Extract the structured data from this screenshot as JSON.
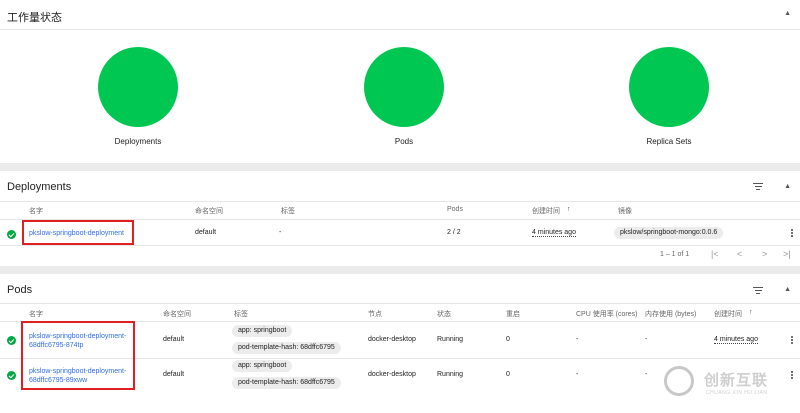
{
  "workload": {
    "title": "工作量状态",
    "items": [
      {
        "label": "Deployments",
        "color": "#00c752"
      },
      {
        "label": "Pods",
        "color": "#00c752"
      },
      {
        "label": "Replica Sets",
        "color": "#00c752"
      }
    ]
  },
  "deployments": {
    "title": "Deployments",
    "headers": {
      "name": "名字",
      "namespace": "命名空间",
      "labels": "标签",
      "pods": "Pods",
      "created": "创建时间",
      "sort": "↑",
      "images": "镜像"
    },
    "rows": [
      {
        "name": "pkslow-springboot-deployment",
        "namespace": "default",
        "labels": "-",
        "pods": "2 / 2",
        "created": "4 minutes ago",
        "image": "pkslow/springboot-mongo:0.0.6"
      }
    ],
    "pagination": {
      "range": "1 – 1 of 1",
      "first": "|<",
      "prev": "<",
      "next": ">",
      "last": ">|"
    }
  },
  "pods": {
    "title": "Pods",
    "headers": {
      "name": "名字",
      "namespace": "命名空间",
      "labels": "标签",
      "node": "节点",
      "status": "状态",
      "restarts": "重启",
      "cpu": "CPU 使用率 (cores)",
      "memory": "内存使用 (bytes)",
      "created": "创建时间",
      "sort": "↑"
    },
    "rows": [
      {
        "name_line1": "pkslow-springboot-deployment-",
        "name_line2": "68dffc6795-874tp",
        "namespace": "default",
        "label1": "app: springboot",
        "label2": "pod-template-hash: 68dffc6795",
        "node": "docker-desktop",
        "status": "Running",
        "restarts": "0",
        "cpu": "-",
        "memory": "-",
        "created": "4 minutes ago"
      },
      {
        "name_line1": "pkslow-springboot-deployment-",
        "name_line2": "68dffc6795-89xww",
        "namespace": "default",
        "label1": "app: springboot",
        "label2": "pod-template-hash: 68dffc6795",
        "node": "docker-desktop",
        "status": "Running",
        "restarts": "0",
        "cpu": "-",
        "memory": "-",
        "created": ""
      }
    ]
  },
  "watermark": {
    "brand": "创新互联",
    "sub": "CHUANG XIN HU LIAN"
  },
  "colors": {
    "accent": "#326de6",
    "success": "#00c752",
    "highlight": "#e02020"
  }
}
